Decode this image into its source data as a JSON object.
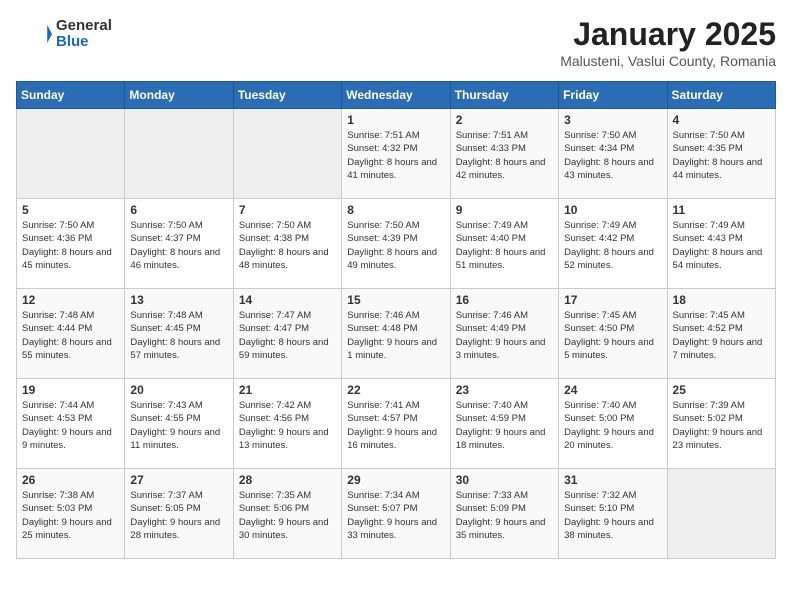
{
  "logo": {
    "general": "General",
    "blue": "Blue"
  },
  "title": "January 2025",
  "subtitle": "Malusteni, Vaslui County, Romania",
  "days_of_week": [
    "Sunday",
    "Monday",
    "Tuesday",
    "Wednesday",
    "Thursday",
    "Friday",
    "Saturday"
  ],
  "weeks": [
    [
      {
        "day": "",
        "info": ""
      },
      {
        "day": "",
        "info": ""
      },
      {
        "day": "",
        "info": ""
      },
      {
        "day": "1",
        "info": "Sunrise: 7:51 AM\nSunset: 4:32 PM\nDaylight: 8 hours and 41 minutes."
      },
      {
        "day": "2",
        "info": "Sunrise: 7:51 AM\nSunset: 4:33 PM\nDaylight: 8 hours and 42 minutes."
      },
      {
        "day": "3",
        "info": "Sunrise: 7:50 AM\nSunset: 4:34 PM\nDaylight: 8 hours and 43 minutes."
      },
      {
        "day": "4",
        "info": "Sunrise: 7:50 AM\nSunset: 4:35 PM\nDaylight: 8 hours and 44 minutes."
      }
    ],
    [
      {
        "day": "5",
        "info": "Sunrise: 7:50 AM\nSunset: 4:36 PM\nDaylight: 8 hours and 45 minutes."
      },
      {
        "day": "6",
        "info": "Sunrise: 7:50 AM\nSunset: 4:37 PM\nDaylight: 8 hours and 46 minutes."
      },
      {
        "day": "7",
        "info": "Sunrise: 7:50 AM\nSunset: 4:38 PM\nDaylight: 8 hours and 48 minutes."
      },
      {
        "day": "8",
        "info": "Sunrise: 7:50 AM\nSunset: 4:39 PM\nDaylight: 8 hours and 49 minutes."
      },
      {
        "day": "9",
        "info": "Sunrise: 7:49 AM\nSunset: 4:40 PM\nDaylight: 8 hours and 51 minutes."
      },
      {
        "day": "10",
        "info": "Sunrise: 7:49 AM\nSunset: 4:42 PM\nDaylight: 8 hours and 52 minutes."
      },
      {
        "day": "11",
        "info": "Sunrise: 7:49 AM\nSunset: 4:43 PM\nDaylight: 8 hours and 54 minutes."
      }
    ],
    [
      {
        "day": "12",
        "info": "Sunrise: 7:48 AM\nSunset: 4:44 PM\nDaylight: 8 hours and 55 minutes."
      },
      {
        "day": "13",
        "info": "Sunrise: 7:48 AM\nSunset: 4:45 PM\nDaylight: 8 hours and 57 minutes."
      },
      {
        "day": "14",
        "info": "Sunrise: 7:47 AM\nSunset: 4:47 PM\nDaylight: 8 hours and 59 minutes."
      },
      {
        "day": "15",
        "info": "Sunrise: 7:46 AM\nSunset: 4:48 PM\nDaylight: 9 hours and 1 minute."
      },
      {
        "day": "16",
        "info": "Sunrise: 7:46 AM\nSunset: 4:49 PM\nDaylight: 9 hours and 3 minutes."
      },
      {
        "day": "17",
        "info": "Sunrise: 7:45 AM\nSunset: 4:50 PM\nDaylight: 9 hours and 5 minutes."
      },
      {
        "day": "18",
        "info": "Sunrise: 7:45 AM\nSunset: 4:52 PM\nDaylight: 9 hours and 7 minutes."
      }
    ],
    [
      {
        "day": "19",
        "info": "Sunrise: 7:44 AM\nSunset: 4:53 PM\nDaylight: 9 hours and 9 minutes."
      },
      {
        "day": "20",
        "info": "Sunrise: 7:43 AM\nSunset: 4:55 PM\nDaylight: 9 hours and 11 minutes."
      },
      {
        "day": "21",
        "info": "Sunrise: 7:42 AM\nSunset: 4:56 PM\nDaylight: 9 hours and 13 minutes."
      },
      {
        "day": "22",
        "info": "Sunrise: 7:41 AM\nSunset: 4:57 PM\nDaylight: 9 hours and 16 minutes."
      },
      {
        "day": "23",
        "info": "Sunrise: 7:40 AM\nSunset: 4:59 PM\nDaylight: 9 hours and 18 minutes."
      },
      {
        "day": "24",
        "info": "Sunrise: 7:40 AM\nSunset: 5:00 PM\nDaylight: 9 hours and 20 minutes."
      },
      {
        "day": "25",
        "info": "Sunrise: 7:39 AM\nSunset: 5:02 PM\nDaylight: 9 hours and 23 minutes."
      }
    ],
    [
      {
        "day": "26",
        "info": "Sunrise: 7:38 AM\nSunset: 5:03 PM\nDaylight: 9 hours and 25 minutes."
      },
      {
        "day": "27",
        "info": "Sunrise: 7:37 AM\nSunset: 5:05 PM\nDaylight: 9 hours and 28 minutes."
      },
      {
        "day": "28",
        "info": "Sunrise: 7:35 AM\nSunset: 5:06 PM\nDaylight: 9 hours and 30 minutes."
      },
      {
        "day": "29",
        "info": "Sunrise: 7:34 AM\nSunset: 5:07 PM\nDaylight: 9 hours and 33 minutes."
      },
      {
        "day": "30",
        "info": "Sunrise: 7:33 AM\nSunset: 5:09 PM\nDaylight: 9 hours and 35 minutes."
      },
      {
        "day": "31",
        "info": "Sunrise: 7:32 AM\nSunset: 5:10 PM\nDaylight: 9 hours and 38 minutes."
      },
      {
        "day": "",
        "info": ""
      }
    ]
  ]
}
